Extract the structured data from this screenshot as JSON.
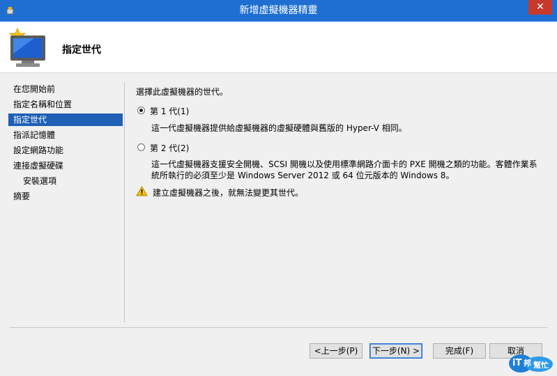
{
  "window": {
    "title": "新增虛擬機器精靈",
    "close_label": "✕"
  },
  "header": {
    "title": "指定世代"
  },
  "nav": {
    "items": [
      {
        "label": "在您開始前",
        "active": false,
        "sub": false
      },
      {
        "label": "指定名稱和位置",
        "active": false,
        "sub": false
      },
      {
        "label": "指定世代",
        "active": true,
        "sub": false
      },
      {
        "label": "指派記憶體",
        "active": false,
        "sub": false
      },
      {
        "label": "設定網路功能",
        "active": false,
        "sub": false
      },
      {
        "label": "連接虛擬硬碟",
        "active": false,
        "sub": false
      },
      {
        "label": "安裝選項",
        "active": false,
        "sub": true
      },
      {
        "label": "摘要",
        "active": false,
        "sub": false
      }
    ]
  },
  "main": {
    "instruction": "選擇此虛擬機器的世代。",
    "gen1": {
      "label": "第 1 代(1)",
      "selected": true,
      "description": "這一代虛擬機器提供給虛擬機器的虛擬硬體與舊版的 Hyper-V 相同。"
    },
    "gen2": {
      "label": "第 2 代(2)",
      "selected": false,
      "description_line1": "這一代虛擬機器支援安全開機、SCSI 開機以及使用標準網路介面卡的 PXE 開機之類的功能。客體作業系",
      "description_line2": "統所執行的必須至少是 Windows Server 2012 或 64 位元版本的 Windows 8。"
    },
    "warning": "建立虛擬機器之後，就無法變更其世代。"
  },
  "buttons": {
    "previous": "<上一步(P)",
    "next": "下一步(N) >",
    "finish": "完成(F)",
    "cancel": "取消"
  },
  "watermark": {
    "logo_text": "iT",
    "logo_sub": "邦",
    "logo_tag": "幫忙"
  },
  "colors": {
    "titlebar": "#1f6fd3",
    "selection": "#1f5fb4",
    "close": "#c7392b",
    "warning": "#f2c200"
  },
  "icons": {
    "app": "hyper-v-app-icon",
    "wizard": "new-virtual-machine-icon",
    "warning": "warning-icon",
    "close": "close-icon"
  }
}
